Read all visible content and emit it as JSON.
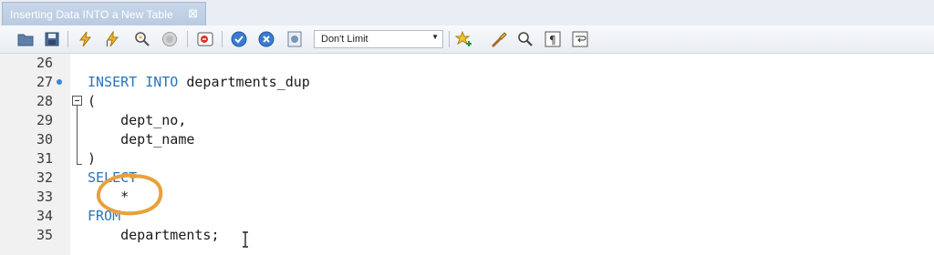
{
  "tab": {
    "title": "Inserting Data INTO a New Table",
    "close_glyph": "⊠"
  },
  "toolbar": {
    "icons": [
      "open-folder-icon",
      "save-icon",
      "execute-icon",
      "execute-selection-icon",
      "explain-icon",
      "stop-icon",
      "toggle-continue-on-error-icon",
      "commit-icon",
      "rollback-icon",
      "autocommit-icon",
      "beautify-icon",
      "find-icon",
      "invisible-chars-icon",
      "word-wrap-icon",
      "add-snippet-icon"
    ],
    "limit_select": {
      "value": "Don't Limit"
    },
    "accent": "#2a73bd"
  },
  "editor": {
    "lines": [
      {
        "num": "26",
        "code": ""
      },
      {
        "num": "27",
        "code": "INSERT INTO departments_dup"
      },
      {
        "num": "28",
        "code": "("
      },
      {
        "num": "29",
        "code": "    dept_no,"
      },
      {
        "num": "30",
        "code": "    dept_name"
      },
      {
        "num": "31",
        "code": ")"
      },
      {
        "num": "32",
        "code": "SELECT"
      },
      {
        "num": "33",
        "code": "    *"
      },
      {
        "num": "34",
        "code": "FROM"
      },
      {
        "num": "35",
        "code": "    departments;"
      }
    ],
    "annotation_color": "#e8a13a"
  }
}
